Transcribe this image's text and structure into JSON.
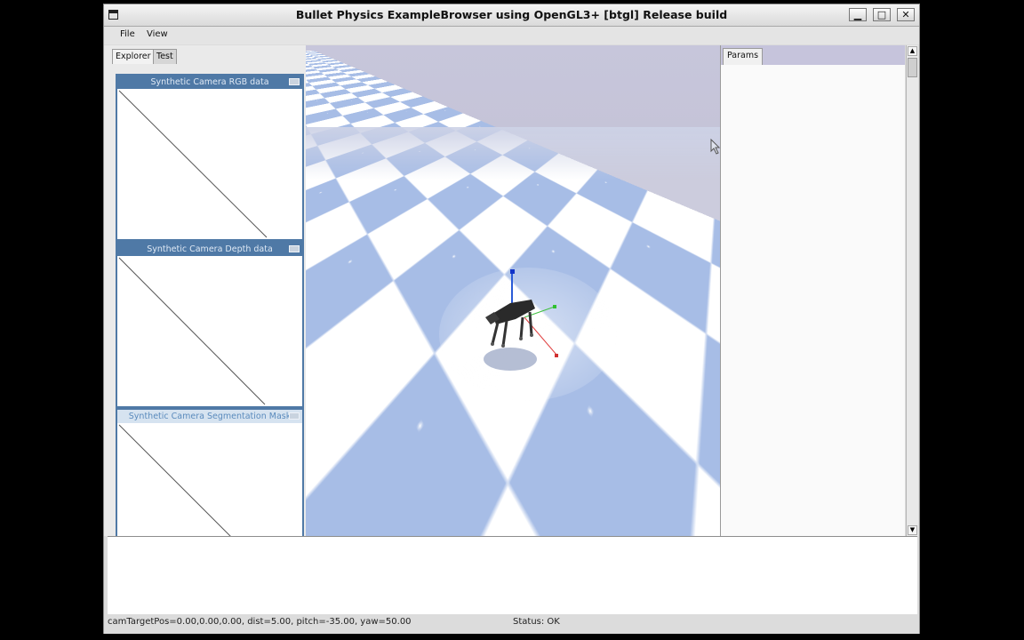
{
  "window": {
    "title": "Bullet Physics ExampleBrowser using OpenGL3+ [btgl] Release build",
    "minimize_glyph": "▁",
    "maximize_glyph": "□",
    "close_glyph": "✕"
  },
  "menu": {
    "items": [
      {
        "label": "File"
      },
      {
        "label": "View"
      }
    ]
  },
  "left_tabs": [
    {
      "label": "Explorer"
    },
    {
      "label": "Test"
    }
  ],
  "camera_windows": [
    {
      "title": "Synthetic Camera RGB data"
    },
    {
      "title": "Synthetic Camera Depth data"
    },
    {
      "title": "Synthetic Camera Segmentation Mask"
    }
  ],
  "right_panel": {
    "tab_label": "Params"
  },
  "status_bar": {
    "camera_info": "camTargetPos=0.00,0.00,0.00, dist=5.00, pitch=-35.00, yaw=50.00",
    "status": "Status: OK"
  },
  "colors": {
    "checker_blue": "#a7bde6",
    "checker_white": "#ffffff",
    "sky": "#c7c6db",
    "cam_window_accent": "#4f79a6"
  },
  "icons": {
    "scroll_up": "up-arrow-icon",
    "scroll_down": "down-arrow-icon",
    "window_menu": "window-menu-icon"
  }
}
